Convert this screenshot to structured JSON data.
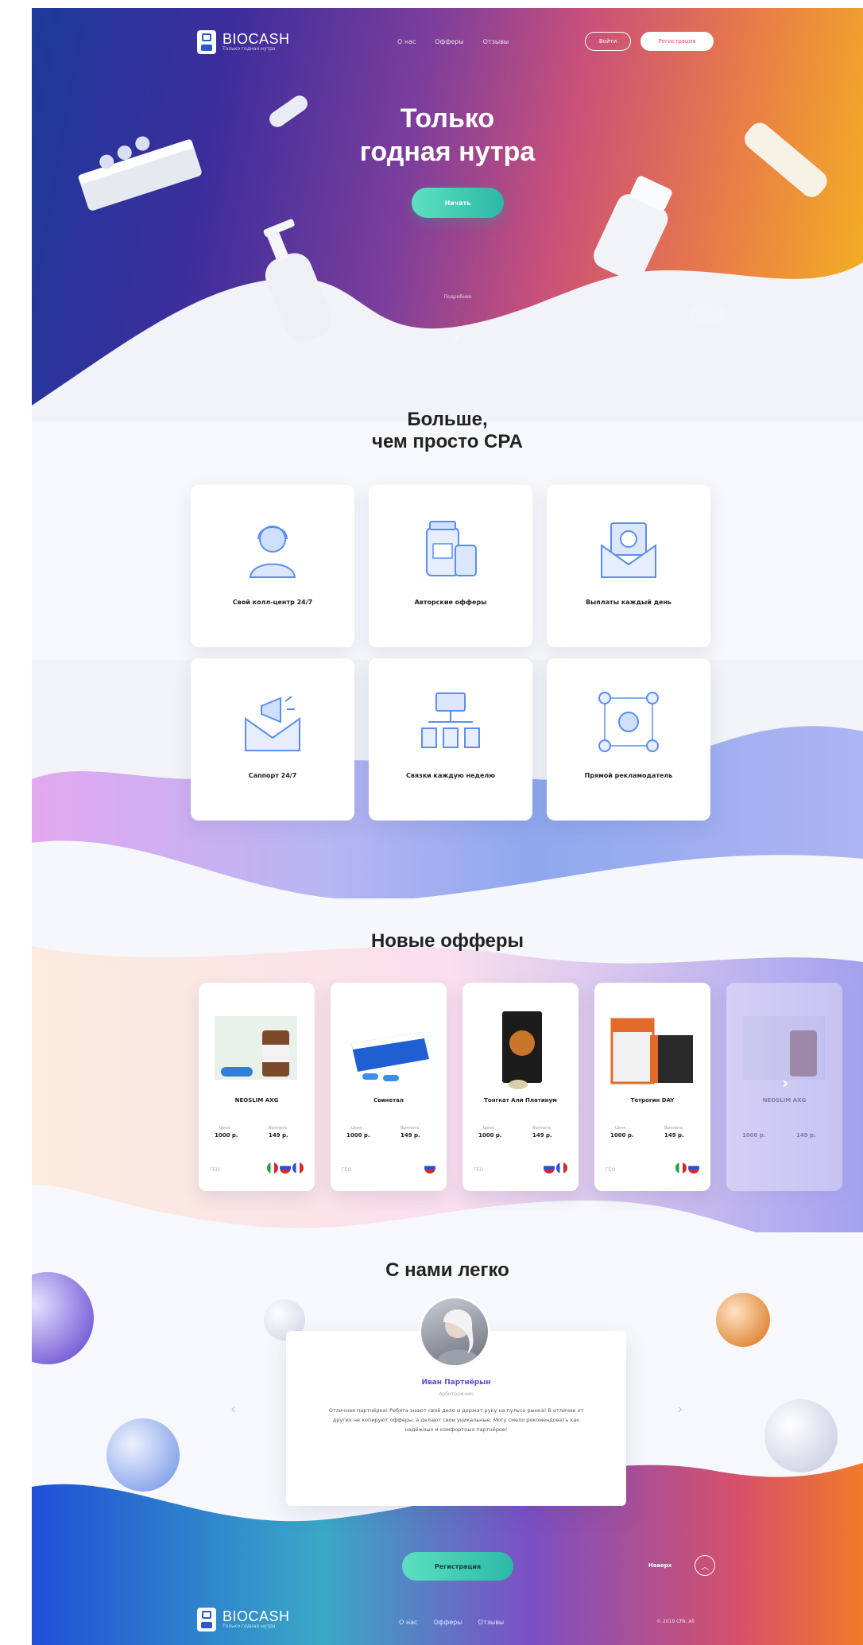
{
  "brand": {
    "name": "BIOCASH",
    "tagline": "Только годная нутра"
  },
  "nav": {
    "links": [
      "О нас",
      "Офферы",
      "Отзывы"
    ],
    "login": "Войти",
    "register": "Регистрация"
  },
  "hero": {
    "title_line1": "Только",
    "title_line2": "годная нутра",
    "cta": "Начать",
    "more": "Подробнее"
  },
  "features": {
    "title_line1": "Больше,",
    "title_line2": "чем просто CPA",
    "items": [
      {
        "label": "Свой колл-центр 24/7",
        "icon": "operator-icon"
      },
      {
        "label": "Авторские офферы",
        "icon": "jars-icon"
      },
      {
        "label": "Выплаты каждый день",
        "icon": "money-envelope-icon"
      },
      {
        "label": "Саппорт 24/7",
        "icon": "megaphone-envelope-icon"
      },
      {
        "label": "Связки каждую неделю",
        "icon": "flowchart-icon"
      },
      {
        "label": "Прямой рекламодатель",
        "icon": "network-icon"
      }
    ]
  },
  "offers": {
    "title": "Новые офферы",
    "price_label": "Цена",
    "payout_label": "Выплата",
    "geo_label": "ГЕО",
    "items": [
      {
        "name": "NEOSLIM AXG",
        "price": "1000 р.",
        "payout": "149 р."
      },
      {
        "name": "Свинетал",
        "price": "1000 р.",
        "payout": "149 р."
      },
      {
        "name": "Тонгкат Али Платинум",
        "price": "1000 р.",
        "payout": "149 р."
      },
      {
        "name": "Тетрогин DAY",
        "price": "1000 р.",
        "payout": "149 р."
      },
      {
        "name": "NEOSLIM AXG",
        "price": "1000 р.",
        "payout": "149 р."
      }
    ]
  },
  "testimonial": {
    "title": "С нами легко",
    "name": "Иван Партнёрын",
    "role": "Арбитражник",
    "text": "Отличная партнёрка! Ребята знают своё дело и держат руку на пульсе рынка! В отличии от других не копируют офферы, а делают свои уникальные. Могу смело рекомендовать как надёжных и комфортных партнёров!"
  },
  "footer": {
    "register": "Регистрация",
    "up": "Наверх",
    "links": [
      "О нас",
      "Офферы",
      "Отзывы"
    ],
    "copyright": "© 2019 CPA. All"
  },
  "colors": {
    "accent_green": "#3ccfb1",
    "purple": "#5b4ad6",
    "hero_blue": "#1d3a9b",
    "hero_orange": "#f3b51e"
  }
}
